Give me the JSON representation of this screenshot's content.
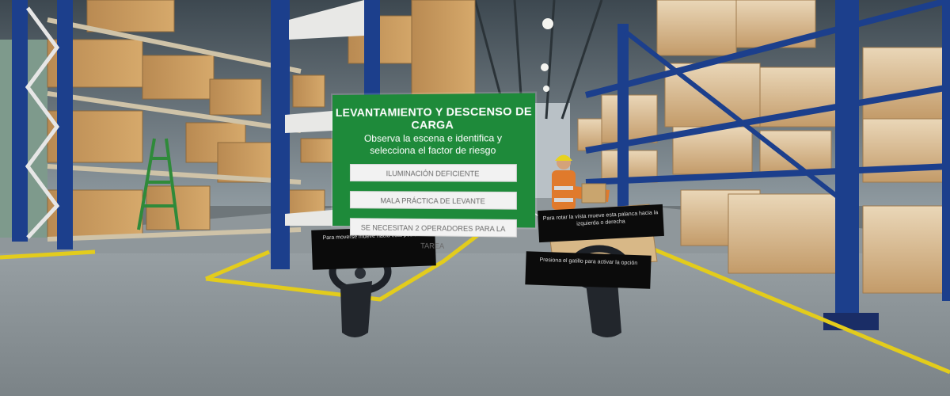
{
  "panel": {
    "title": "LEVANTAMIENTO Y DESCENSO DE CARGA",
    "instruction": "Observa la escena e identifica y selecciona el factor de riesgo",
    "options": [
      {
        "label": "ILUMINACIÓN DEFICIENTE"
      },
      {
        "label": "MALA PRÁCTICA DE LEVANTE"
      },
      {
        "label": "SE NECESITAN 2 OPERADORES PARA LA TAREA"
      }
    ]
  },
  "tooltips": {
    "left_thumbstick": "Para moverse mueve hacia esta posición",
    "right_thumbstick": "Para rotar la vista mueve esta palanca hacia la izquierda o derecha",
    "right_trigger": "Presiona el gatillo para activar la opción"
  },
  "colors": {
    "panel_green": "#1e8a3a",
    "rack_blue": "#1c3f8c",
    "floor_line_yellow": "#e3cc1c",
    "box_tan": "#c79a60"
  }
}
